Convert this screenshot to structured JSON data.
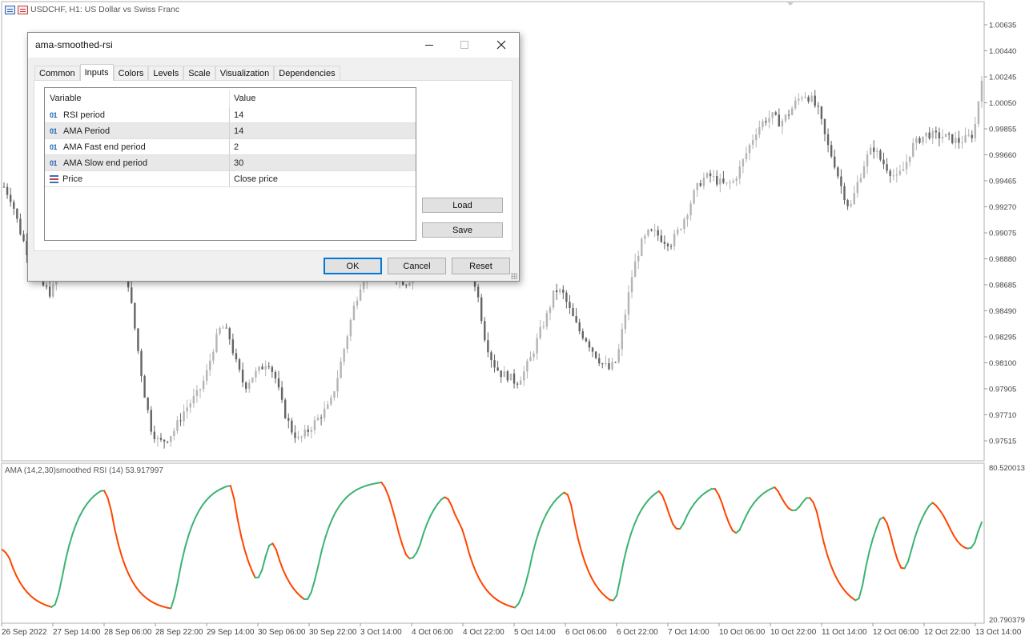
{
  "chart_window": {
    "title": "USDCHF, H1:  US Dollar vs Swiss Franc",
    "indicator_label": "AMA (14,2,30)smoothed RSI (14) 53.917997",
    "price_axis": [
      "1.00635",
      "1.00440",
      "1.00245",
      "1.00050",
      "0.99855",
      "0.99660",
      "0.99465",
      "0.99270",
      "0.99075",
      "0.98880",
      "0.98685",
      "0.98490",
      "0.98295",
      "0.98100",
      "0.97905",
      "0.97710",
      "0.97515"
    ],
    "indicator_axis": {
      "top": "80.520013",
      "bottom": "20.790379"
    },
    "time_axis": [
      "26 Sep 2022",
      "27 Sep 14:00",
      "28 Sep 06:00",
      "28 Sep 22:00",
      "29 Sep 14:00",
      "30 Sep 06:00",
      "30 Sep 22:00",
      "3 Oct 14:00",
      "4 Oct 06:00",
      "4 Oct 22:00",
      "5 Oct 14:00",
      "6 Oct 06:00",
      "6 Oct 22:00",
      "7 Oct 14:00",
      "10 Oct 06:00",
      "10 Oct 22:00",
      "11 Oct 14:00",
      "12 Oct 06:00",
      "12 Oct 22:00",
      "13 Oct 14:00"
    ],
    "colors": {
      "rsi_up": "#3cb371",
      "rsi_down": "#ff4500",
      "candle_up": "#b4b4b4",
      "candle_down": "#646464"
    },
    "price_series": [
      0.9942,
      0.9932,
      0.991,
      0.9893,
      0.9878,
      0.9868,
      0.9862,
      0.9875,
      0.989,
      0.9905,
      0.9915,
      0.9925,
      0.993,
      0.9932,
      0.9918,
      0.9895,
      0.987,
      0.983,
      0.979,
      0.976,
      0.975,
      0.9753,
      0.976,
      0.9772,
      0.978,
      0.9787,
      0.98,
      0.9822,
      0.9838,
      0.983,
      0.9808,
      0.9792,
      0.98,
      0.9805,
      0.9812,
      0.9798,
      0.9775,
      0.976,
      0.9752,
      0.9758,
      0.9765,
      0.9772,
      0.9778,
      0.98,
      0.9825,
      0.985,
      0.987,
      0.988,
      0.9885,
      0.9882,
      0.9878,
      0.9872,
      0.987,
      0.988,
      0.9888,
      0.9902,
      0.9903,
      0.9903,
      0.99,
      0.9902,
      0.9885,
      0.9862,
      0.9828,
      0.981,
      0.9802,
      0.98,
      0.9795,
      0.9803,
      0.9815,
      0.9832,
      0.9846,
      0.9865,
      0.9862,
      0.9848,
      0.9835,
      0.9828,
      0.9818,
      0.981,
      0.9805,
      0.9812,
      0.9845,
      0.9878,
      0.9898,
      0.9907,
      0.9907,
      0.9902,
      0.99,
      0.991,
      0.9923,
      0.9938,
      0.9948,
      0.995,
      0.9946,
      0.9943,
      0.9946,
      0.9958,
      0.9972,
      0.9985,
      0.9992,
      0.9995,
      0.999,
      0.9996,
      1.0005,
      1.0012,
      1.0008,
      0.9998,
      0.9975,
      0.996,
      0.994,
      0.9925,
      0.9945,
      0.9962,
      0.9972,
      0.9962,
      0.9955,
      0.9948,
      0.9956,
      0.9972,
      0.9978,
      0.9982,
      0.998,
      0.998,
      0.9978,
      0.9976,
      0.9978,
      0.9982,
      1.0025
    ]
  },
  "dialog": {
    "title": "ama-smoothed-rsi",
    "window_buttons": {
      "minimize": "—",
      "maximize": "☐",
      "close": "✕"
    },
    "tabs": [
      "Common",
      "Inputs",
      "Colors",
      "Levels",
      "Scale",
      "Visualization",
      "Dependencies"
    ],
    "active_tab": "Inputs",
    "table": {
      "headers": [
        "Variable",
        "Value"
      ],
      "rows": [
        {
          "type": "01",
          "variable": "RSI period",
          "value": "14"
        },
        {
          "type": "01",
          "variable": "AMA Period",
          "value": "14"
        },
        {
          "type": "01",
          "variable": "AMA Fast end period",
          "value": "2"
        },
        {
          "type": "01",
          "variable": "AMA Slow end period",
          "value": "30"
        },
        {
          "type": "list",
          "variable": "Price",
          "value": "Close price"
        }
      ]
    },
    "load_label": "Load",
    "save_label": "Save",
    "ok_label": "OK",
    "cancel_label": "Cancel",
    "reset_label": "Reset"
  }
}
